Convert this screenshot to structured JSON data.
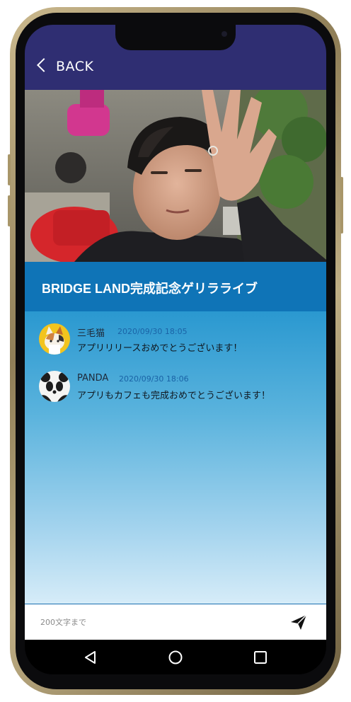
{
  "header": {
    "back_label": "BACK"
  },
  "live": {
    "title": "BRIDGE LAND完成記念ゲリラライブ"
  },
  "comments": [
    {
      "user": "三毛猫",
      "time": "2020/09/30 18:05",
      "text": "アプリリリースおめでとうございます！",
      "avatar": "calico-cat-avatar"
    },
    {
      "user": "PANDA",
      "time": "2020/09/30 18:06",
      "text": "アプリもカフェも完成おめでとうございます！",
      "avatar": "panda-avatar"
    }
  ],
  "input": {
    "placeholder": "200文字まで",
    "value": ""
  },
  "icons": {
    "back": "chevron-left-icon",
    "send": "paper-plane-icon",
    "nav_back": "triangle-back-icon",
    "nav_home": "circle-home-icon",
    "nav_recents": "square-recents-icon"
  },
  "colors": {
    "header": "#2f2e72",
    "title_bar": "#0f74b7",
    "comments_top": "#2a98d0",
    "comments_bottom": "#d6ecf8",
    "timestamp": "#1a63a6"
  }
}
